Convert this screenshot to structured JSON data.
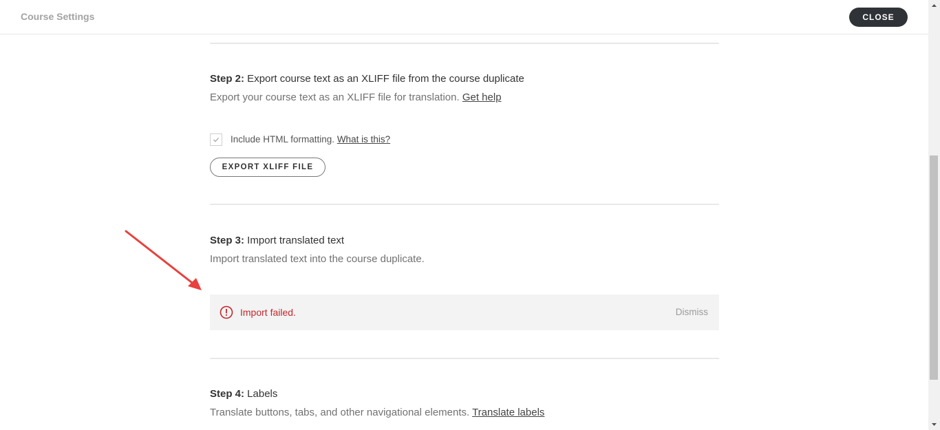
{
  "header": {
    "title": "Course Settings",
    "close_label": "CLOSE"
  },
  "step2": {
    "title_prefix": "Step 2:",
    "title_text": " Export course text as an XLIFF file from the course duplicate",
    "description": "Export your course text as an XLIFF file for translation. ",
    "help_link": "Get help",
    "checkbox_checked": true,
    "checkbox_label": "Include HTML formatting. ",
    "what_link": "What is this?",
    "export_button": "EXPORT XLIFF FILE"
  },
  "step3": {
    "title_prefix": "Step 3:",
    "title_text": " Import translated text",
    "description": "Import translated text into the course duplicate.",
    "alert": {
      "message": "Import failed.",
      "dismiss": "Dismiss",
      "color": "#c0282d"
    }
  },
  "step4": {
    "title_prefix": "Step 4:",
    "title_text": " Labels",
    "description": "Translate buttons, tabs, and other navigational elements. ",
    "link": "Translate labels"
  },
  "icons": {
    "check": "checkmark-icon",
    "alert": "error-circle-icon",
    "annotation": "red-arrow-annotation",
    "scroll_up": "scroll-up-arrow-icon",
    "scroll_down": "scroll-down-arrow-icon"
  },
  "colors": {
    "accent_dark": "#2f3337",
    "error": "#c0282d",
    "annotation": "#e8413e"
  }
}
